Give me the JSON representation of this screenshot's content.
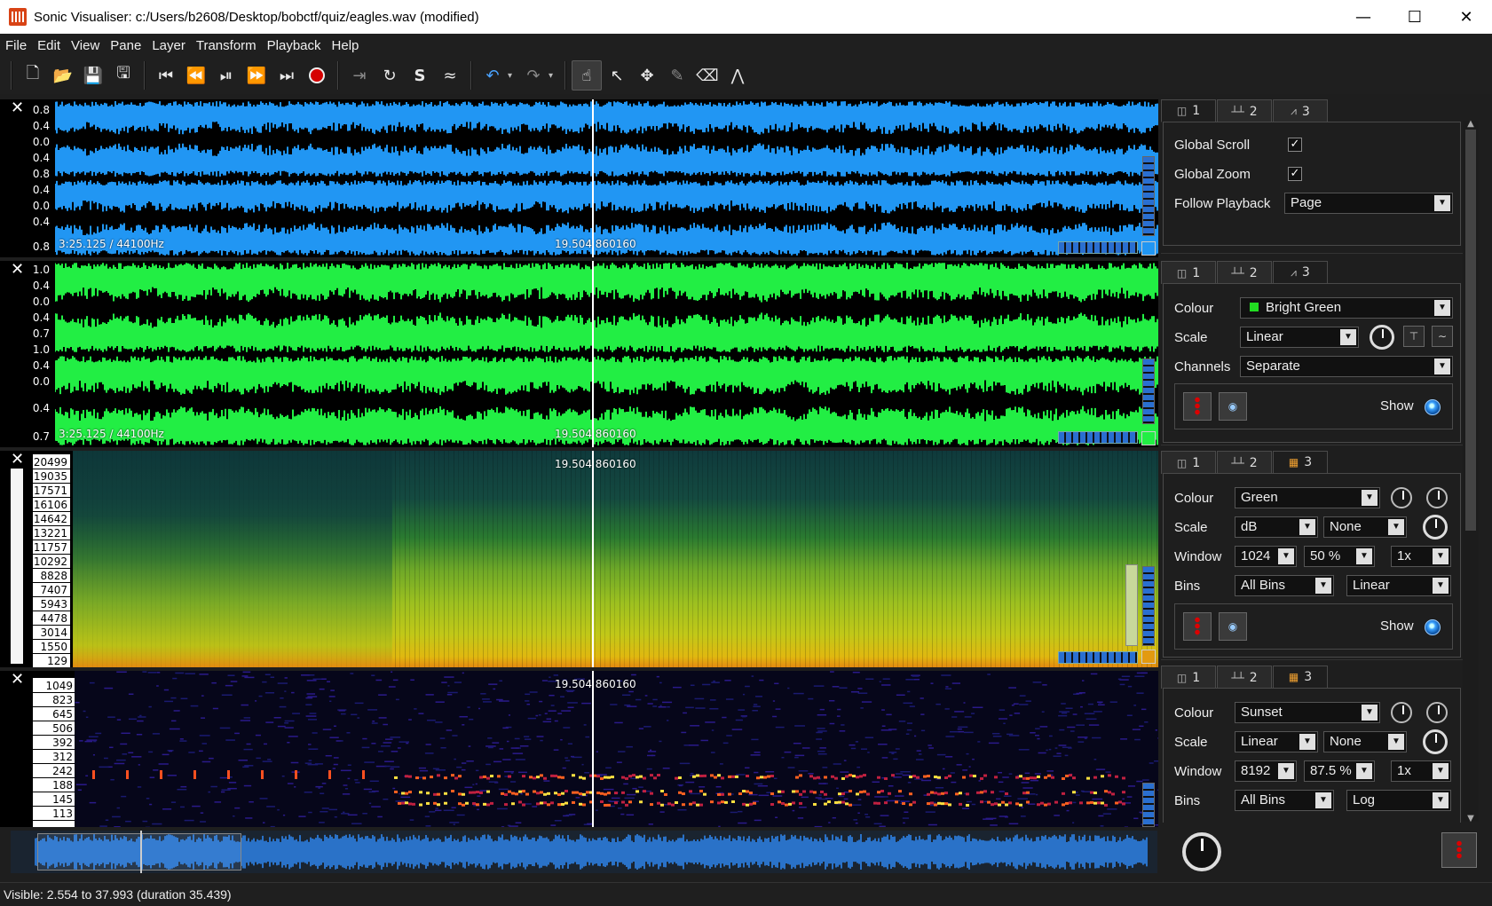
{
  "window": {
    "title": "Sonic Visualiser: c:/Users/b2608/Desktop/bobctf/quiz/eagles.wav (modified)",
    "minimize": "—",
    "maximize": "☐",
    "close": "✕"
  },
  "menu": [
    "File",
    "Edit",
    "View",
    "Pane",
    "Layer",
    "Transform",
    "Playback",
    "Help"
  ],
  "toolbar": {
    "file_buttons": [
      "new-icon",
      "open-icon",
      "save-icon",
      "save-as-icon"
    ],
    "transport": [
      "rewind-start-icon",
      "rewind-icon",
      "play-pause-icon",
      "fast-forward-icon",
      "ffwd-end-icon",
      "record-icon"
    ],
    "play_modes": [
      "play-selection-icon",
      "loop-icon",
      "solo-icon",
      "follow-icon"
    ],
    "edit": [
      "undo-icon",
      "redo-icon"
    ],
    "tools": [
      "navigate-icon",
      "select-icon",
      "move-icon",
      "draw-icon",
      "erase-icon",
      "measure-icon"
    ]
  },
  "panes": [
    {
      "type": "waveform",
      "color": "#2196f3",
      "scale_ticks": [
        "0.8",
        "0.4",
        "0.0",
        "0.4",
        "0.8",
        "0.4",
        "0.0",
        "0.4",
        "0.8"
      ],
      "info": "3:25.125 / 44100Hz",
      "playhead_label": "19.504  860160"
    },
    {
      "type": "waveform",
      "color": "#22ee44",
      "scale_ticks": [
        "1.0",
        "0.4",
        "0.0",
        "0.4",
        "0.7",
        "1.0",
        "0.4",
        "0.0",
        "0.4",
        "0.7"
      ],
      "info": "3:25.125 / 44100Hz",
      "playhead_label": "19.504  860160"
    },
    {
      "type": "spectrogram",
      "color_map": "Green",
      "freq_ticks": [
        "20499",
        "19035",
        "17571",
        "16106",
        "14642",
        "13221",
        "11757",
        "10292",
        "8828",
        "7407",
        "5943",
        "4478",
        "3014",
        "1550",
        "129"
      ],
      "playhead_label": "19.504  860160"
    },
    {
      "type": "spectrogram",
      "color_map": "Sunset",
      "freq_ticks": [
        "1049",
        "823",
        "645",
        "506",
        "392",
        "312",
        "242",
        "188",
        "145",
        "113"
      ],
      "playhead_label": "19.504  860160"
    }
  ],
  "properties": [
    {
      "tabs": [
        "1",
        "2",
        "3"
      ],
      "active_tab": 0,
      "global_scroll_label": "Global Scroll",
      "global_zoom_label": "Global Zoom",
      "follow_label": "Follow Playback",
      "follow_value": "Page",
      "check": "✓"
    },
    {
      "tabs": [
        "1",
        "2",
        "3"
      ],
      "active_tab": 2,
      "colour_label": "Colour",
      "colour_value": "Bright Green",
      "scale_label": "Scale",
      "scale_value": "Linear",
      "channels_label": "Channels",
      "channels_value": "Separate",
      "show_label": "Show"
    },
    {
      "tabs": [
        "1",
        "2",
        "3"
      ],
      "active_tab": 2,
      "colour_label": "Colour",
      "colour_value": "Green",
      "scale_label": "Scale",
      "scale_value": "dB",
      "scale_value2": "None",
      "window_label": "Window",
      "window_value": "1024",
      "overlap_value": "50 %",
      "oversample_value": "1x",
      "bins_label": "Bins",
      "bins_value": "All Bins",
      "bins_scale": "Linear",
      "show_label": "Show"
    },
    {
      "tabs": [
        "1",
        "2",
        "3"
      ],
      "active_tab": 2,
      "colour_label": "Colour",
      "colour_value": "Sunset",
      "scale_label": "Scale",
      "scale_value": "Linear",
      "scale_value2": "None",
      "window_label": "Window",
      "window_value": "8192",
      "overlap_value": "87.5 %",
      "oversample_value": "1x",
      "bins_label": "Bins",
      "bins_value": "All Bins",
      "bins_scale": "Log"
    }
  ],
  "status": "Visible: 2.554 to 37.993 (duration 35.439)"
}
